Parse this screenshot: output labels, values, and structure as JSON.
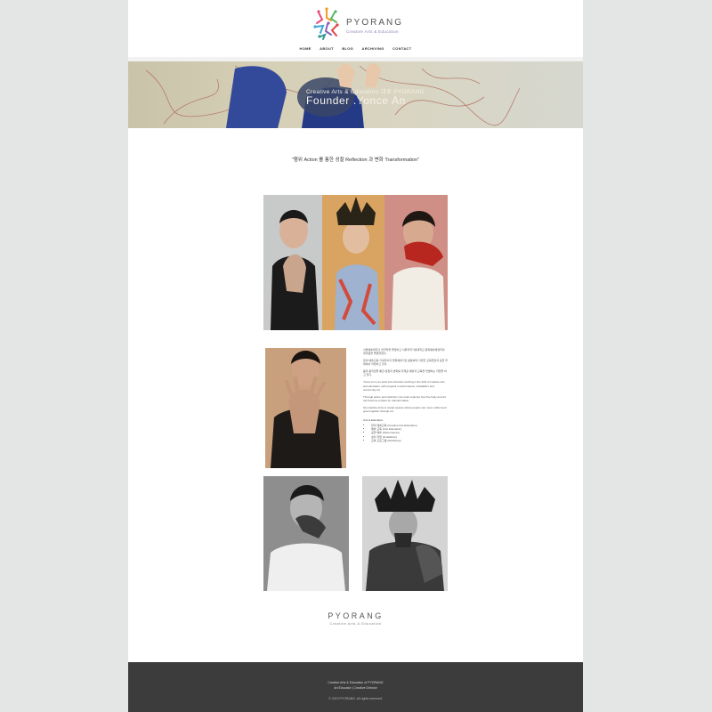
{
  "brand": {
    "name": "PYORANG",
    "tagline": "Creative Arts & Education"
  },
  "nav": {
    "items": [
      {
        "label": "HOME"
      },
      {
        "label": "ABOUT"
      },
      {
        "label": "BLOG"
      },
      {
        "label": "ARCHIVING"
      },
      {
        "label": "CONTACT"
      }
    ]
  },
  "banner": {
    "subtitle": "Creative Arts & Education 대표 PYORANG",
    "title": "Founder .Yonce An"
  },
  "quote": "\"행위 Action 를 통한 성찰 Reflection 과 변화 Transformation\"",
  "bio": {
    "paragraphs": [
      "서울예술대학교 연극학을 졸업하고 서울과학기술대학교 문화예술경영학과 대학원을 졸업하였다.",
      "창의 예술교육 기획자이자 행위예술가로 활동하며 다양한 교육현장과 공연 무대에서 작업하고 있다.",
      "몸과 움직임을 통한 성찰과 변화를 주제로 예술과 교육을 연결하는 작업을 하고 있다.",
      "Yonce An is an artist and educator working in the field of creative arts and education, with projects in performance, installation and community art.",
      "Through action and reflection, the work explores how the body and art can become a place for transformation.",
      "His practice aims to create spaces where people can meet, reflect and grow together through art."
    ],
    "list_title": "Arts & Education",
    "list": [
      "창의 예술교육 (Creative Arts Education)",
      "예술 교육 (Arts Education)",
      "공연 예술 (Performance)",
      "설치 작업 (Installation)",
      "교육 프로그램 (Workshop)"
    ]
  },
  "footer_logo": {
    "name": "PYORANG",
    "tagline": "Creative Arts & Education"
  },
  "footer": {
    "line1": "Creative Arts & Education of PYORANG",
    "line2": "Art Educator  |  Creative Director",
    "line3": "© 2019 PYORANG. All rights reserved."
  },
  "colors": {
    "page_bg": "#e4e6e6",
    "content_bg": "#ffffff",
    "footer_bg": "#3c3c3c",
    "accent_purple": "#8a7fb6"
  }
}
